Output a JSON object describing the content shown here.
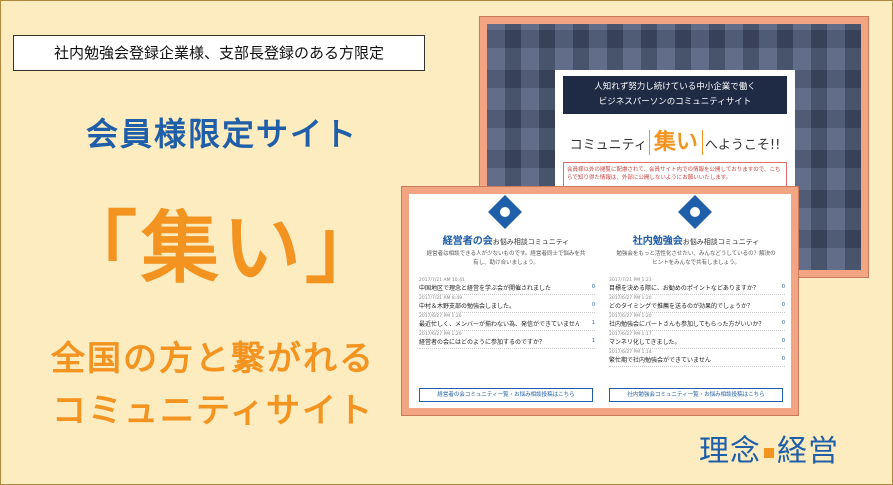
{
  "banner": {
    "limited_tag": "社内勉強会登録企業様、支部長登録のある方限定",
    "members_site": "会員様限定サイト",
    "site_name": "「集い」",
    "tagline_1": "全国の方と繋がれる",
    "tagline_2": "コミュニティサイト",
    "logo_left": "理念",
    "logo_right": "経営",
    "colors": {
      "background": "#fdecc0",
      "blue": "#1f5ea8",
      "orange": "#f39420"
    }
  },
  "back_screenshot": {
    "head_line_1": "人知れず努力し続けている中小企業で働く",
    "head_line_2": "ビジネスパーソンのコミュニティサイト",
    "welcome_pre": "コミュニティ",
    "welcome_big": "集い",
    "welcome_post": "へようこそ!!",
    "note": "会員様以外の閲覧に配慮されて、会員サイト内での情報を公開しておりますので、こちらで知り得た情報は、外部に公開しないようにお願いいたします。"
  },
  "front_screenshot": {
    "left": {
      "title_main": "経営者の会",
      "title_sub": "お悩み相談コミュニティ",
      "desc": "経営者は相談できる人が少ないものです。経営者同士で悩みを共有し、助け合いましょう。",
      "items": [
        {
          "date": "2017/7/21 AM 10:41",
          "title": "中国地区で理念と経営を学ぶ会が開催されました",
          "count": "0"
        },
        {
          "date": "2017/7/21 AM 8:49",
          "title": "中村＆木野支部の勉強会しました。",
          "count": "0"
        },
        {
          "date": "2017/6/27 PM 1:20",
          "title": "最近忙しく、メンバーが揃わない為、発信ができていませんA",
          "count": "1"
        },
        {
          "date": "2017/6/27 PM 1:20",
          "title": "経営者の会にはどのように参加するのですか？",
          "count": "1"
        }
      ],
      "button": "経営者の会コミュニティ一覧・お悩み相談投稿はこちら"
    },
    "right": {
      "title_main": "社内勉強会",
      "title_sub": "お悩み相談コミュニティ",
      "desc": "勉強会をもっと活性化させたい、みんなどうしているの？解決のヒントをみんなで共有しましょう。",
      "items": [
        {
          "date": "2017/7/21 PM 1:23",
          "title": "目標を決める際に、お勧めのポイントなどありますか？",
          "count": "0"
        },
        {
          "date": "2017/6/27 PM 1:20",
          "title": "どのタイミングで推薦を送るのが効果的でしょうか？",
          "count": "0"
        },
        {
          "date": "2017/6/27 PM 1:20",
          "title": "社内勉強会にパートさんも参加してもらった方がいいか？",
          "count": "0"
        },
        {
          "date": "2017/6/27 PM 1:17",
          "title": "マンネリ化してきました。",
          "count": "0"
        },
        {
          "date": "2017/6/27 PM 1:14",
          "title": "繁忙期で社内勉強会ができていません",
          "count": "0"
        }
      ],
      "button": "社内勉強会コミュニティ一覧・お悩み相談投稿はこちら"
    }
  }
}
